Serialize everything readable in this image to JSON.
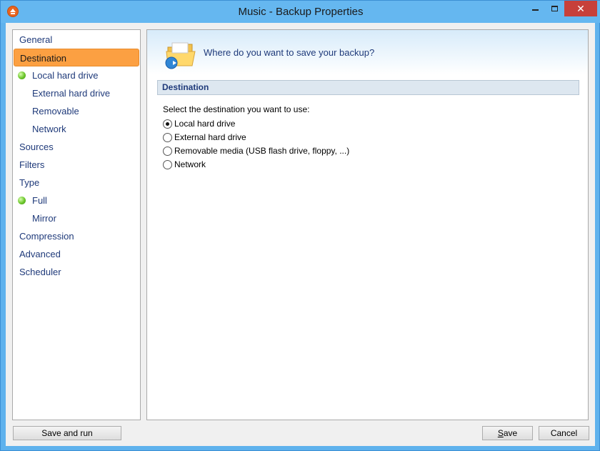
{
  "window": {
    "title": "Music - Backup Properties",
    "close_glyph": "✕"
  },
  "nav": {
    "items": [
      {
        "label": "General",
        "level": "top"
      },
      {
        "label": "Destination",
        "level": "top",
        "selected": true
      },
      {
        "label": "Local hard drive",
        "level": "sub",
        "bullet": true
      },
      {
        "label": "External hard drive",
        "level": "sub"
      },
      {
        "label": "Removable",
        "level": "sub"
      },
      {
        "label": "Network",
        "level": "sub"
      },
      {
        "label": "Sources",
        "level": "top"
      },
      {
        "label": "Filters",
        "level": "top"
      },
      {
        "label": "Type",
        "level": "top"
      },
      {
        "label": "Full",
        "level": "sub",
        "bullet": true
      },
      {
        "label": "Mirror",
        "level": "sub"
      },
      {
        "label": "Compression",
        "level": "top"
      },
      {
        "label": "Advanced",
        "level": "top"
      },
      {
        "label": "Scheduler",
        "level": "top"
      }
    ]
  },
  "content": {
    "header_text": "Where do you want to save your backup?",
    "section_title": "Destination",
    "prompt": "Select the destination you want to use:",
    "options": [
      {
        "label": "Local hard drive",
        "checked": true
      },
      {
        "label": "External hard drive",
        "checked": false
      },
      {
        "label": "Removable media (USB flash drive, floppy, ...)",
        "checked": false
      },
      {
        "label": "Network",
        "checked": false
      }
    ]
  },
  "buttons": {
    "save_and_run": "Save and run",
    "save_first": "S",
    "save_rest": "ave",
    "cancel": "Cancel"
  },
  "colors": {
    "selected_nav": "#fca042",
    "link_text": "#1f3a7a",
    "titlebar": "#65b7f0",
    "close_button": "#c7403a"
  }
}
